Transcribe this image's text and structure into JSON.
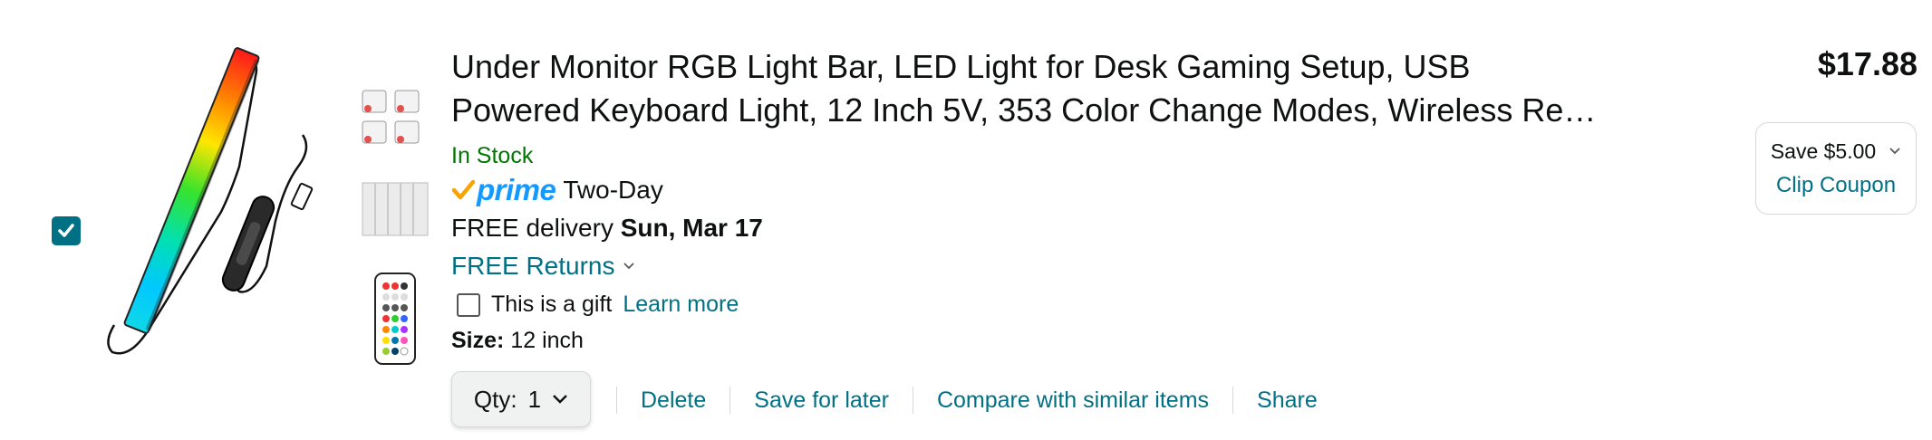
{
  "item": {
    "selected": true,
    "title_line1": "Under Monitor RGB Light Bar, LED Light for Desk Gaming Setup, USB",
    "title_line2": "Powered Keyboard Light, 12 Inch 5V, 353 Color Change Modes, Wireless Re…",
    "stock": "In Stock",
    "prime_word": "prime",
    "prime_speed": "Two-Day",
    "delivery_prefix": "FREE delivery",
    "delivery_date": "Sun, Mar 17",
    "returns": "FREE Returns",
    "gift_label": "This is a gift",
    "gift_link": "Learn more",
    "size_label": "Size:",
    "size_value": "12 inch",
    "qty_label": "Qty:",
    "qty_value": "1",
    "price": "$17.88",
    "coupon_save": "Save $5.00",
    "coupon_link": "Clip Coupon"
  },
  "actions": {
    "delete": "Delete",
    "save_for_later": "Save for later",
    "compare": "Compare with similar items",
    "share": "Share"
  },
  "colors": {
    "link": "#007185",
    "in_stock": "#007600",
    "prime_blue": "#1399FF",
    "check_teal": "#007185"
  }
}
